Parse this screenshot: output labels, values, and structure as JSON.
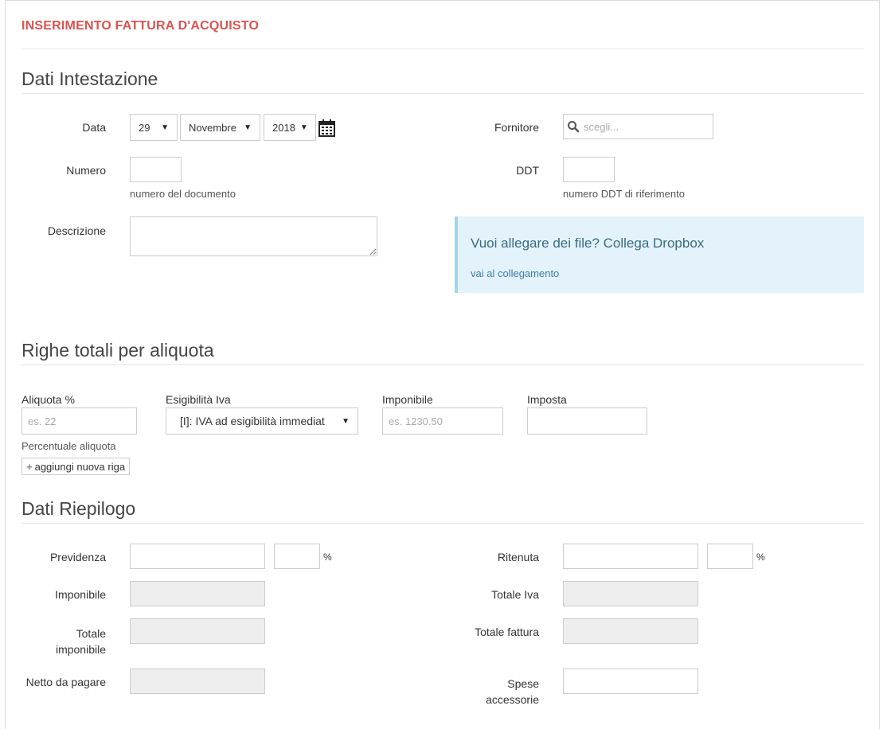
{
  "page_title": "INSERIMENTO FATTURA D'ACQUISTO",
  "sections": {
    "intestazione": "Dati Intestazione",
    "righe": "Righe totali per aliquota",
    "riepilogo": "Dati Riepilogo"
  },
  "intestazione": {
    "data_label": "Data",
    "day": "29",
    "month": "Novembre",
    "year": "2018",
    "fornitore_label": "Fornitore",
    "fornitore_placeholder": "scegli...",
    "numero_label": "Numero",
    "numero_help": "numero del documento",
    "ddt_label": "DDT",
    "ddt_help": "numero DDT di riferimento",
    "descrizione_label": "Descrizione"
  },
  "dropbox": {
    "title": "Vuoi allegare dei file? Collega Dropbox",
    "link": "vai al collegamento"
  },
  "righe": {
    "aliquota_label": "Aliquota %",
    "aliquota_placeholder": "es. 22",
    "aliquota_help": "Percentuale aliquota",
    "esigibilita_label": "Esigibilità Iva",
    "esigibilita_value": "[I]: IVA ad esigibilità immediat",
    "imponibile_label": "Imponibile",
    "imponibile_placeholder": "es. 1230.50",
    "imposta_label": "Imposta",
    "add_row": "aggiungi nuova riga"
  },
  "riepilogo": {
    "previdenza": "Previdenza",
    "ritenuta": "Ritenuta",
    "percent": "%",
    "imponibile": "Imponibile",
    "totale_iva": "Totale Iva",
    "totale_imponibile_1": "Totale",
    "totale_imponibile_2": "imponibile",
    "totale_fattura": "Totale fattura",
    "netto": "Netto da pagare",
    "spese_1": "Spese",
    "spese_2": "accessorie"
  },
  "colors": {
    "title": "#d9534f",
    "info_bg": "#e4f3fb",
    "info_border": "#9fd6e8",
    "disabled": "#eeeeee"
  },
  "icons": {
    "calendar": "calendar-icon",
    "search": "search-icon",
    "plus": "plus-icon",
    "caret": "caret-down-icon"
  }
}
